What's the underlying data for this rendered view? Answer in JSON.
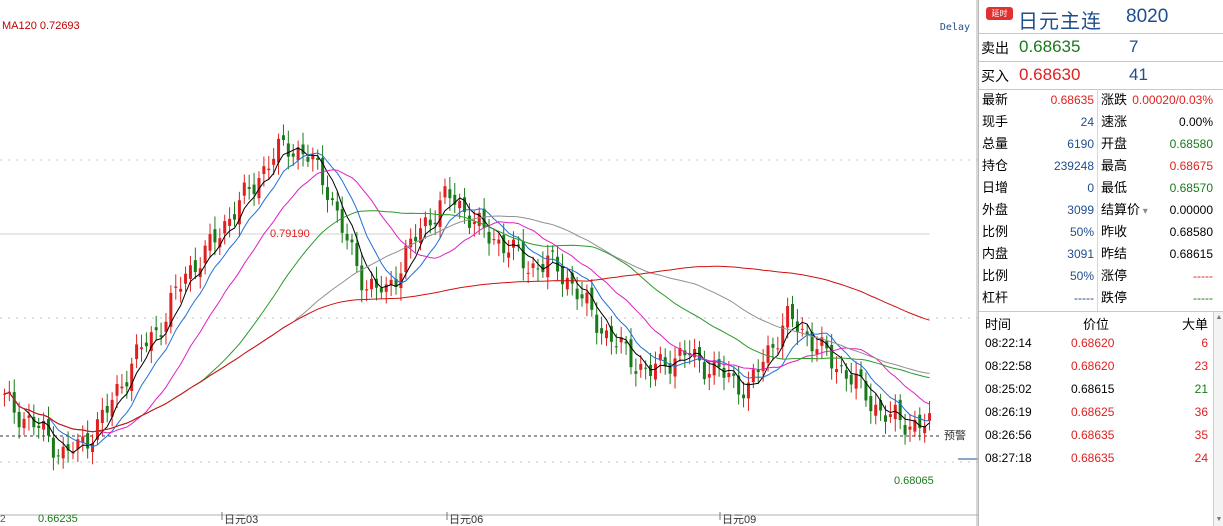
{
  "chart": {
    "ma_label": "MA120 0.72693",
    "delay_label": "Delay",
    "alert_label": "预警",
    "high_label": "0.79190",
    "low_label": "0.66235",
    "last_low_label": "0.68065",
    "x_ticks": [
      "日元03",
      "日元06",
      "日元09"
    ],
    "left_edge_tick": "2"
  },
  "chart_data": {
    "type": "line",
    "title": "",
    "series_note": "candlestick with moving averages",
    "ylim": [
      0.645,
      0.835
    ],
    "high": 0.7919,
    "low": 0.66235,
    "last_low": 0.68065,
    "ma120_value": 0.72693,
    "candles_close_trend": [
      0.69,
      0.683,
      0.677,
      0.668,
      0.674,
      0.684,
      0.7,
      0.712,
      0.722,
      0.74,
      0.747,
      0.76,
      0.77,
      0.782,
      0.79,
      0.786,
      0.775,
      0.752,
      0.735,
      0.732,
      0.748,
      0.76,
      0.77,
      0.764,
      0.754,
      0.751,
      0.742,
      0.744,
      0.738,
      0.726,
      0.715,
      0.708,
      0.7,
      0.706,
      0.708,
      0.703,
      0.699,
      0.694,
      0.71,
      0.722,
      0.715,
      0.706,
      0.7,
      0.69,
      0.683,
      0.681,
      0.68
    ]
  },
  "panel": {
    "badge": "延时",
    "title": "日元主连",
    "code": "8020",
    "sell_label": "卖出",
    "sell_price": "0.68635",
    "sell_vol": "7",
    "buy_label": "买入",
    "buy_price": "0.68630",
    "buy_vol": "41",
    "stats_left": [
      {
        "label": "最新",
        "value": "0.68635",
        "color": "#e02020"
      },
      {
        "label": "现手",
        "value": "24",
        "color": "#1f4e8c"
      },
      {
        "label": "总量",
        "value": "6190",
        "color": "#1f4e8c"
      },
      {
        "label": "持仓",
        "value": "239248",
        "color": "#1f4e8c"
      },
      {
        "label": "日增",
        "value": "0",
        "color": "#1f4e8c"
      },
      {
        "label": "外盘",
        "value": "3099",
        "color": "#1f4e8c"
      },
      {
        "label": "比例",
        "value": "50%",
        "color": "#1f4e8c"
      },
      {
        "label": "内盘",
        "value": "3091",
        "color": "#1f4e8c"
      },
      {
        "label": "比例",
        "value": "50%",
        "color": "#1f4e8c"
      },
      {
        "label": "杠杆",
        "value": "-----",
        "color": "#1f4e8c"
      }
    ],
    "stats_right": [
      {
        "label": "涨跌",
        "value": "0.00020/0.03%",
        "color": "#e02020"
      },
      {
        "label": "速涨",
        "value": "0.00%",
        "color": "#000000"
      },
      {
        "label": "开盘",
        "value": "0.68580",
        "color": "#1a7a1a"
      },
      {
        "label": "最高",
        "value": "0.68675",
        "color": "#e02020"
      },
      {
        "label": "最低",
        "value": "0.68570",
        "color": "#1a7a1a"
      },
      {
        "label": "结算价",
        "value": "0.00000",
        "color": "#000000"
      },
      {
        "label": "昨收",
        "value": "0.68580",
        "color": "#000000"
      },
      {
        "label": "昨结",
        "value": "0.68615",
        "color": "#000000"
      },
      {
        "label": "涨停",
        "value": "-----",
        "color": "#e02020"
      },
      {
        "label": "跌停",
        "value": "-----",
        "color": "#1a7a1a"
      }
    ],
    "trades_header": {
      "time": "时间",
      "price": "价位",
      "vol": "大单"
    },
    "trades": [
      {
        "time": "08:22:14",
        "price": "0.68620",
        "vol": "6",
        "pcolor": "#e02020",
        "vcolor": "#e02020"
      },
      {
        "time": "08:22:58",
        "price": "0.68620",
        "vol": "23",
        "pcolor": "#e02020",
        "vcolor": "#e02020"
      },
      {
        "time": "08:25:02",
        "price": "0.68615",
        "vol": "21",
        "pcolor": "#000000",
        "vcolor": "#1a7a1a"
      },
      {
        "time": "08:26:19",
        "price": "0.68625",
        "vol": "36",
        "pcolor": "#e02020",
        "vcolor": "#e02020"
      },
      {
        "time": "08:26:56",
        "price": "0.68635",
        "vol": "35",
        "pcolor": "#e02020",
        "vcolor": "#e02020"
      },
      {
        "time": "08:27:18",
        "price": "0.68635",
        "vol": "24",
        "pcolor": "#e02020",
        "vcolor": "#e02020"
      }
    ],
    "colors": {
      "up": "#e02020",
      "down": "#1a7a1a",
      "blue": "#1f4e8c"
    }
  }
}
